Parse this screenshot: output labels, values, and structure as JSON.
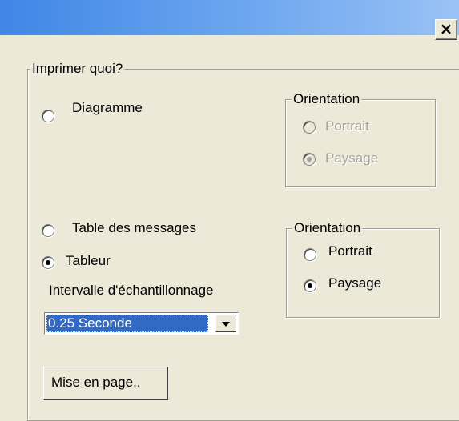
{
  "window": {
    "close_glyph": "×"
  },
  "print_group": {
    "title": "Imprimer quoi?",
    "option_diagram": "Diagramme",
    "option_message_table": "Table des messages",
    "option_spreadsheet": "Tableur",
    "selected": "Tableur",
    "sampling_label": "Intervalle d'échantillonnage",
    "sampling_value": "0.25 Seconde",
    "page_setup_label": "Mise en page.."
  },
  "diagram_orientation": {
    "title": "Orientation",
    "portrait": "Portrait",
    "landscape": "Paysage",
    "selected": "Paysage",
    "enabled": false
  },
  "table_orientation": {
    "title": "Orientation",
    "portrait": "Portrait",
    "landscape": "Paysage",
    "selected": "Paysage",
    "enabled": true
  },
  "icons": {
    "close": "close-icon",
    "dropdown": "chevron-down-icon"
  },
  "colors": {
    "dialog_bg": "#ece9d8",
    "titlebar": "#3f86e6",
    "selection": "#316ac5"
  }
}
